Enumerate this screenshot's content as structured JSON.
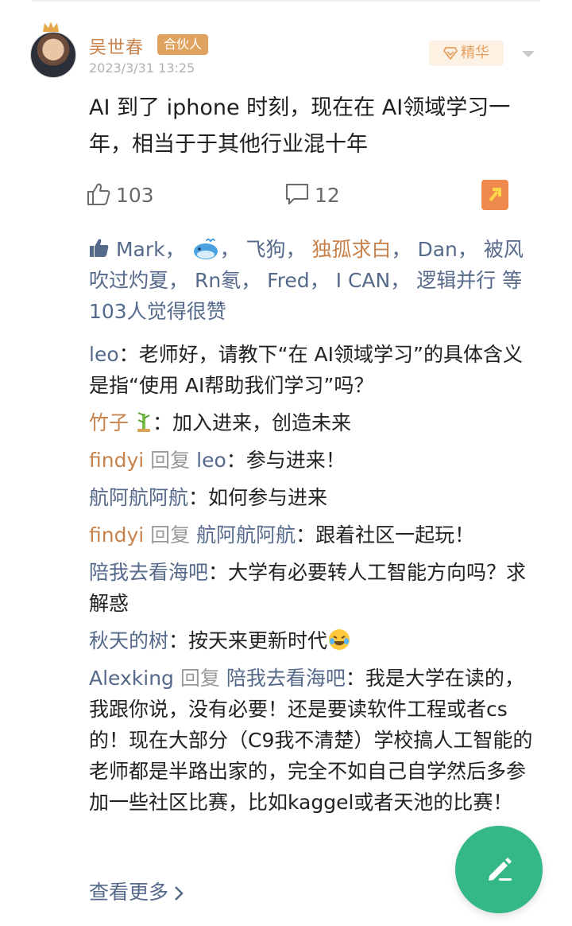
{
  "author": {
    "name": "吴世春",
    "badge": "合伙人",
    "time": "2023/3/31 13:25"
  },
  "essence_label": "精华",
  "post": {
    "text": "AI 到了 iphone 时刻，现在在 AI领域学习一年，相当于于其他行业混十年"
  },
  "actions": {
    "likes": "103",
    "comments": "12"
  },
  "likers": {
    "names": [
      "Mark",
      "飞狗",
      "独孤求白",
      "Dan",
      "被风吹过灼夏",
      "Rn氡",
      "Fred",
      "I CAN",
      "逻辑并行"
    ],
    "summary": "等103人觉得很赞"
  },
  "comments": [
    {
      "user": "leo",
      "text": "老师好，请教下“在 AI领域学习”的具体含义是指“使用 AI帮助我们学习”吗？"
    },
    {
      "user": "竹子",
      "text": "加入进来，创造未来"
    },
    {
      "user": "findyi",
      "reply_label": "回复",
      "reply_to": "leo",
      "text": "参与进来！"
    },
    {
      "user": "航阿航阿航",
      "text": "如何参与进来"
    },
    {
      "user": "findyi",
      "reply_label": "回复",
      "reply_to": "航阿航阿航",
      "text": "跟着社区一起玩！"
    },
    {
      "user": "陪我去看海吧",
      "text": "大学有必要转人工智能方向吗？求解惑"
    },
    {
      "user": "秋天的树",
      "text": "按天来更新时代"
    },
    {
      "user": "Alexking",
      "reply_label": "回复",
      "reply_to": "陪我去看海吧",
      "text": "我是大学在读的，我跟你说，没有必要！还是要读软件工程或者cs的！现在大部分（C9我不清楚）学校搞人工智能的老师都是半路出家的，完全不如自己自学然后多参加一些社区比赛，比如kaggel或者天池的比赛！"
    }
  ],
  "see_more": "查看更多",
  "colors": {
    "author": "#c8834d",
    "link": "#55698a",
    "fab": "#33b886",
    "share": "#f08a4c"
  },
  "icons": [
    "crown-icon",
    "diamond-icon",
    "chevron-down-icon",
    "thumb-up-icon",
    "comment-icon",
    "share-icon",
    "whale-emoji-icon",
    "bamboo-emoji-icon",
    "laugh-emoji-icon",
    "chevron-right-icon",
    "pencil-icon"
  ]
}
